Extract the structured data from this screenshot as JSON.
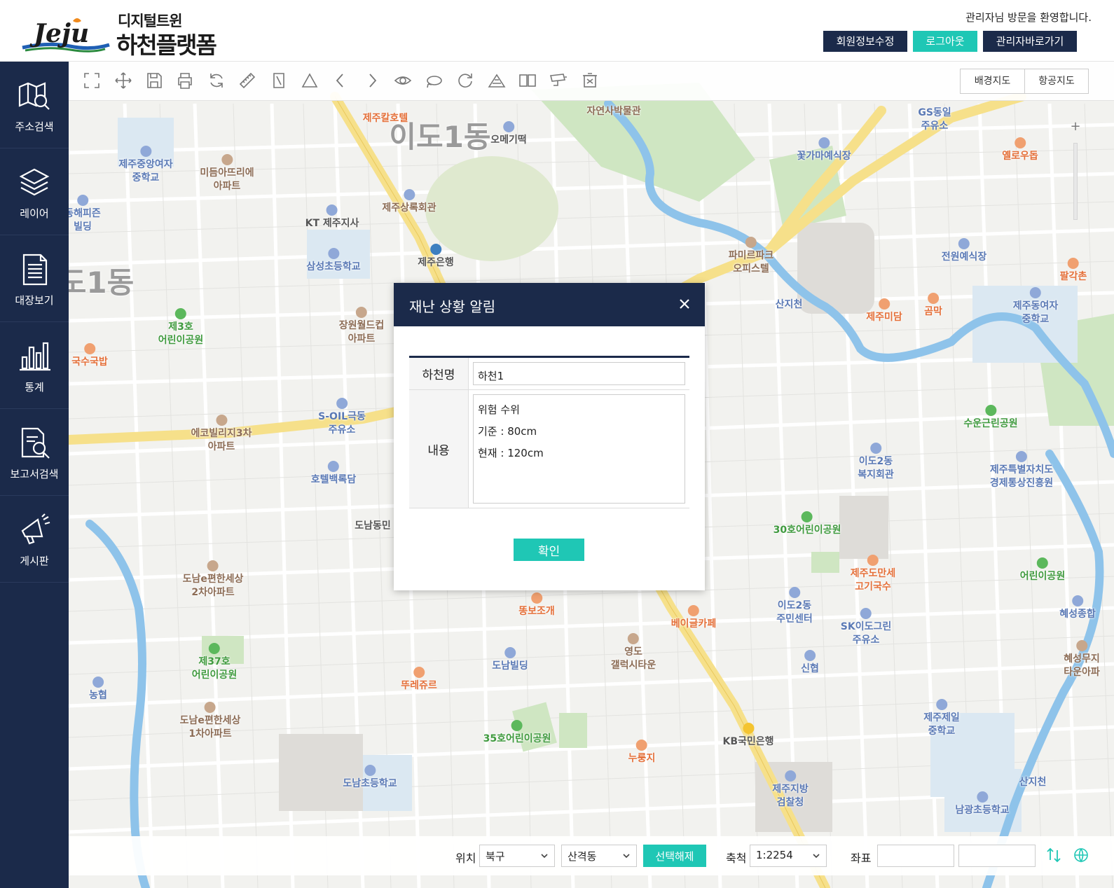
{
  "header": {
    "logo_wordmark": "Jeju",
    "logo_subtitle": "디지털트윈",
    "logo_title": "하천플랫폼",
    "welcome": "관리자님 방문을 환영합니다.",
    "buttons": {
      "profile": "회원정보수정",
      "logout": "로그아웃",
      "admin": "관리자바로가기"
    }
  },
  "sidebar": {
    "items": [
      {
        "label": "주소검색",
        "icon": "map-search-icon"
      },
      {
        "label": "레이어",
        "icon": "layers-icon"
      },
      {
        "label": "대장보기",
        "icon": "ledger-icon"
      },
      {
        "label": "통계",
        "icon": "bar-chart-icon"
      },
      {
        "label": "보고서검색",
        "icon": "report-search-icon"
      },
      {
        "label": "게시판",
        "icon": "megaphone-icon"
      }
    ]
  },
  "toolbar": {
    "tools": [
      "fullscreen-icon",
      "pan-icon",
      "save-icon",
      "print-icon",
      "refresh-icon",
      "ruler-icon",
      "area-measure-icon",
      "triangle-icon",
      "prev-icon",
      "next-icon",
      "eye-icon",
      "rotate-left-icon",
      "rotate-right-icon",
      "terrain-icon",
      "split-view-icon",
      "cctv-icon",
      "clear-icon"
    ],
    "map_types": [
      "배경지도",
      "항공지도"
    ]
  },
  "map": {
    "labels": [
      {
        "text": "이도1동",
        "style": "big"
      },
      {
        "text": "도1동",
        "style": "big"
      },
      {
        "text": "제주칼호텔",
        "style": "orange"
      },
      {
        "text": "오메기떡",
        "style": "gray"
      },
      {
        "text": "자연사박물관",
        "style": "brown"
      },
      {
        "text": "GS동일\n주유소",
        "style": "blue"
      },
      {
        "text": "제주중앙여자\n중학교",
        "style": "blue"
      },
      {
        "text": "미듬아뜨리에\n아파트",
        "style": "brown"
      },
      {
        "text": "꽃가마예식장",
        "style": "blue"
      },
      {
        "text": "옐로우돕",
        "style": "orange"
      },
      {
        "text": "동해피즌\n빌딩",
        "style": "blue"
      },
      {
        "text": "KT 제주지사",
        "style": "gray"
      },
      {
        "text": "제주상록회관",
        "style": "brown"
      },
      {
        "text": "삼성초등학교",
        "style": "blue"
      },
      {
        "text": "제주은행",
        "style": "gray"
      },
      {
        "text": "파미르파크\n오피스텔",
        "style": "brown"
      },
      {
        "text": "전원예식장",
        "style": "blue"
      },
      {
        "text": "팔각촌",
        "style": "orange"
      },
      {
        "text": "제3호\n어린이공원",
        "style": "green"
      },
      {
        "text": "장원월드컵\n아파트",
        "style": "brown"
      },
      {
        "text": "산지천",
        "style": "blue"
      },
      {
        "text": "제주미담",
        "style": "orange"
      },
      {
        "text": "곰막",
        "style": "orange"
      },
      {
        "text": "제주동여자\n중학교",
        "style": "blue"
      },
      {
        "text": "국수국밥",
        "style": "orange"
      },
      {
        "text": "S-OIL극동\n주유소",
        "style": "blue"
      },
      {
        "text": "수운근린공원",
        "style": "green"
      },
      {
        "text": "에코빌리지3차\n아파트",
        "style": "brown"
      },
      {
        "text": "이도2동\n복지회관",
        "style": "blue"
      },
      {
        "text": "제주특별자치도\n경제통상진흥원",
        "style": "blue"
      },
      {
        "text": "호텔백록담",
        "style": "blue"
      },
      {
        "text": "도남동민",
        "style": "gray"
      },
      {
        "text": "30호어린이공원",
        "style": "green"
      },
      {
        "text": "도남e편한세상\n2차아파트",
        "style": "brown"
      },
      {
        "text": "제주도만세\n고기국수",
        "style": "orange"
      },
      {
        "text": "어린이공원",
        "style": "green"
      },
      {
        "text": "똥보조개",
        "style": "orange"
      },
      {
        "text": "이도2동\n주민센터",
        "style": "blue"
      },
      {
        "text": "베이글카페",
        "style": "orange"
      },
      {
        "text": "혜성종합",
        "style": "blue"
      },
      {
        "text": "SK이도그린\n주유소",
        "style": "blue"
      },
      {
        "text": "제37호\n어린이공원",
        "style": "green"
      },
      {
        "text": "도남빌딩",
        "style": "blue"
      },
      {
        "text": "영도\n갤럭시타운",
        "style": "brown"
      },
      {
        "text": "신협",
        "style": "blue"
      },
      {
        "text": "혜성무지\n타운아파",
        "style": "brown"
      },
      {
        "text": "농협",
        "style": "blue"
      },
      {
        "text": "뚜레쥬르",
        "style": "orange"
      },
      {
        "text": "도남e편한세상\n1차아파트",
        "style": "brown"
      },
      {
        "text": "제주제일\n중학교",
        "style": "blue"
      },
      {
        "text": "35호어린이공원",
        "style": "green"
      },
      {
        "text": "KB국민은행",
        "style": "gray"
      },
      {
        "text": "누룽지",
        "style": "orange"
      },
      {
        "text": "산지천",
        "style": "blue"
      },
      {
        "text": "도남초등학교",
        "style": "blue"
      },
      {
        "text": "제주지방\n검찰청",
        "style": "blue"
      },
      {
        "text": "남광초등학교",
        "style": "blue"
      }
    ]
  },
  "bottombar": {
    "location_label": "위치",
    "district": "북구",
    "dong": "산격동",
    "deselect": "선택해제",
    "scale_label": "축척",
    "scale": "1:2254",
    "coord_label": "좌표",
    "coord_x": "",
    "coord_y": ""
  },
  "dialog": {
    "title": "재난 상황 알림",
    "river_label": "하천명",
    "river_value": "하천1",
    "content_label": "내용",
    "content_lines": [
      "위험 수위",
      "기준 : 80cm",
      "현재 : 120cm"
    ],
    "confirm": "확인"
  },
  "colors": {
    "navy": "#1b2a4a",
    "teal": "#1fc7b5",
    "map_bg": "#f2f2ef",
    "river": "#8ec3ea",
    "park": "#cfe6c2",
    "main_road": "#f6e08a"
  }
}
